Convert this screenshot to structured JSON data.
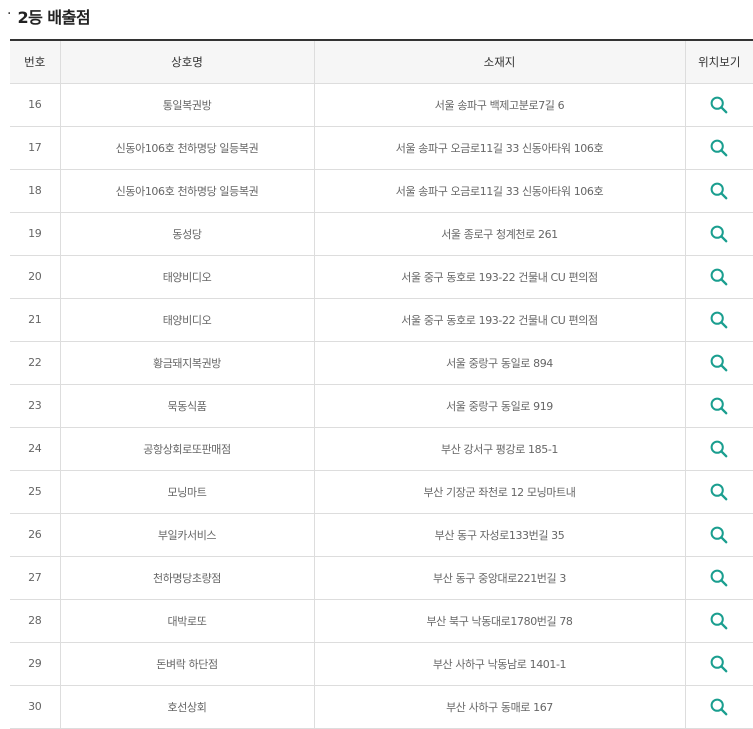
{
  "section": {
    "bullet": "·",
    "title": "2등 배출점"
  },
  "table": {
    "headers": [
      "번호",
      "상호명",
      "소재지",
      "위치보기"
    ],
    "rows": [
      {
        "no": "16",
        "name": "통일복권방",
        "address": "서울 송파구 백제고분로7길 6"
      },
      {
        "no": "17",
        "name": "신동아106호 천하명당 일등복권",
        "address": "서울 송파구 오금로11길 33 신동아타워 106호"
      },
      {
        "no": "18",
        "name": "신동아106호 천하명당 일등복권",
        "address": "서울 송파구 오금로11길 33 신동아타워 106호"
      },
      {
        "no": "19",
        "name": "동성당",
        "address": "서울 종로구 청계천로 261"
      },
      {
        "no": "20",
        "name": "태양비디오",
        "address": "서울 중구 동호로 193-22 건물내 CU 편의점"
      },
      {
        "no": "21",
        "name": "태양비디오",
        "address": "서울 중구 동호로 193-22 건물내 CU 편의점"
      },
      {
        "no": "22",
        "name": "황금돼지복권방",
        "address": "서울 중랑구 동일로 894"
      },
      {
        "no": "23",
        "name": "묵동식품",
        "address": "서울 중랑구 동일로 919"
      },
      {
        "no": "24",
        "name": "공항상회로또판매점",
        "address": "부산 강서구 평강로 185-1"
      },
      {
        "no": "25",
        "name": "모닝마트",
        "address": "부산 기장군 좌천로 12 모닝마트내"
      },
      {
        "no": "26",
        "name": "부일카서비스",
        "address": "부산 동구 자성로133번길 35"
      },
      {
        "no": "27",
        "name": "천하명당초량점",
        "address": "부산 동구 중앙대로221번길 3"
      },
      {
        "no": "28",
        "name": "대박로또",
        "address": "부산 북구 낙동대로1780번길 78"
      },
      {
        "no": "29",
        "name": "돈벼락 하단점",
        "address": "부산 사하구 낙동남로 1401-1"
      },
      {
        "no": "30",
        "name": "호선상회",
        "address": "부산 사하구 동매로 167"
      }
    ]
  },
  "icons": {
    "location": "search-icon"
  },
  "colors": {
    "icon": "#1a9e8f",
    "header_bg": "#f6f6f6",
    "header_border": "#333333",
    "row_border": "#dddddd"
  }
}
